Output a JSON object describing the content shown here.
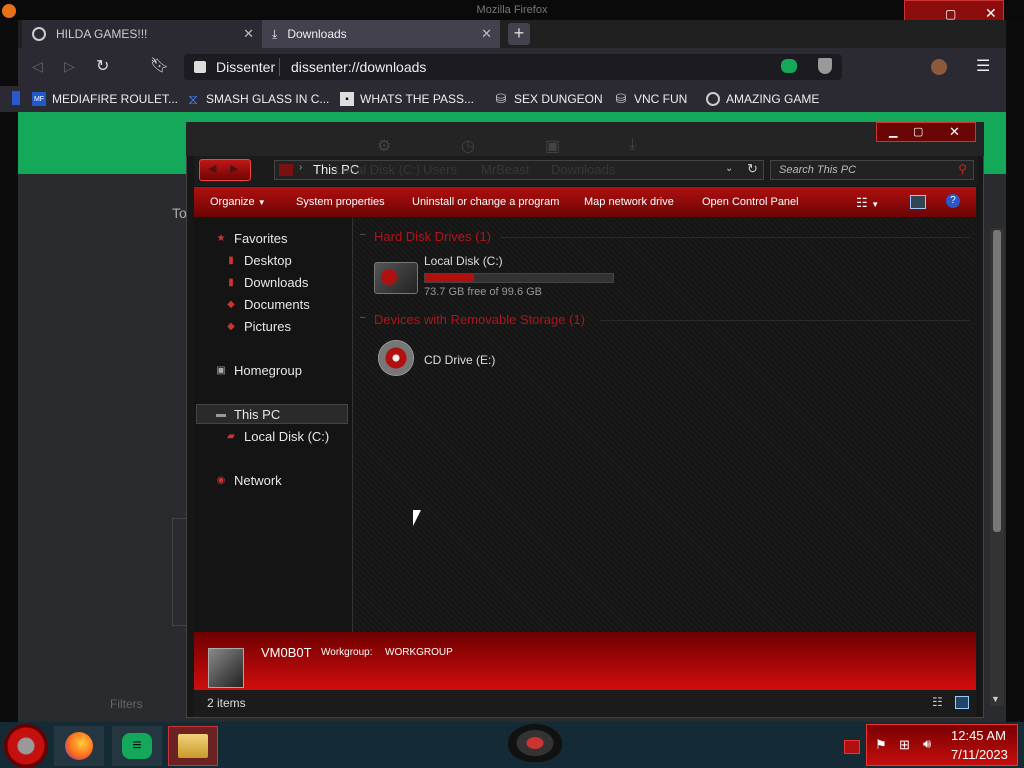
{
  "firefox": {
    "title": "Mozilla Firefox",
    "tabs": [
      {
        "label": "HILDA GAMES!!!",
        "icon": "globe-icon"
      },
      {
        "label": "Downloads",
        "icon": "download-icon"
      }
    ],
    "url": {
      "identity": "Dissenter",
      "address": "dissenter://downloads"
    },
    "bookmarks": [
      {
        "label": "MEDIAFIRE ROULET...",
        "icon": "mediafire-icon"
      },
      {
        "label": "SMASH GLASS IN C...",
        "icon": "hourglass-icon"
      },
      {
        "label": "WHATS THE PASS...",
        "icon": "lock-icon"
      },
      {
        "label": "SEX DUNGEON",
        "icon": "server-icon"
      },
      {
        "label": "VNC FUN",
        "icon": "server-icon"
      },
      {
        "label": "AMAZING GAME",
        "icon": "globe-icon"
      }
    ],
    "page_text": {
      "partial_left": "To",
      "partial_bottom": "Filters"
    }
  },
  "explorer": {
    "ghost_tabs": [
      "Local Disk (C:)",
      "Users",
      "MrBeast",
      "Downloads"
    ],
    "address": "This PC",
    "search_placeholder": "Search This PC",
    "commands": [
      "Organize",
      "System properties",
      "Uninstall or change a program",
      "Map network drive",
      "Open Control Panel"
    ],
    "nav": {
      "favorites": "Favorites",
      "favorites_items": [
        "Desktop",
        "Downloads",
        "Documents",
        "Pictures"
      ],
      "homegroup": "Homegroup",
      "this_pc": "This PC",
      "this_pc_items": [
        "Local Disk (C:)"
      ],
      "network": "Network"
    },
    "groups": [
      {
        "header": "Hard Disk Drives (1)"
      },
      {
        "header": "Devices with Removable Storage (1)"
      }
    ],
    "drive_c": {
      "name": "Local Disk (C:)",
      "free_text": "73.7 GB free of 99.6 GB",
      "used_fraction": 0.26
    },
    "drive_e": {
      "name": "CD Drive (E:)"
    },
    "details": {
      "computer_name": "VM0B0T",
      "workgroup_label": "Workgroup:",
      "workgroup_value": "WORKGROUP"
    },
    "status": {
      "items": "2 items"
    }
  },
  "taskbar": {
    "time": "12:45 AM",
    "date": "7/11/2023"
  },
  "colors": {
    "accent_red": "#b01010",
    "green": "#13a85a",
    "taskbar": "#142a34"
  }
}
